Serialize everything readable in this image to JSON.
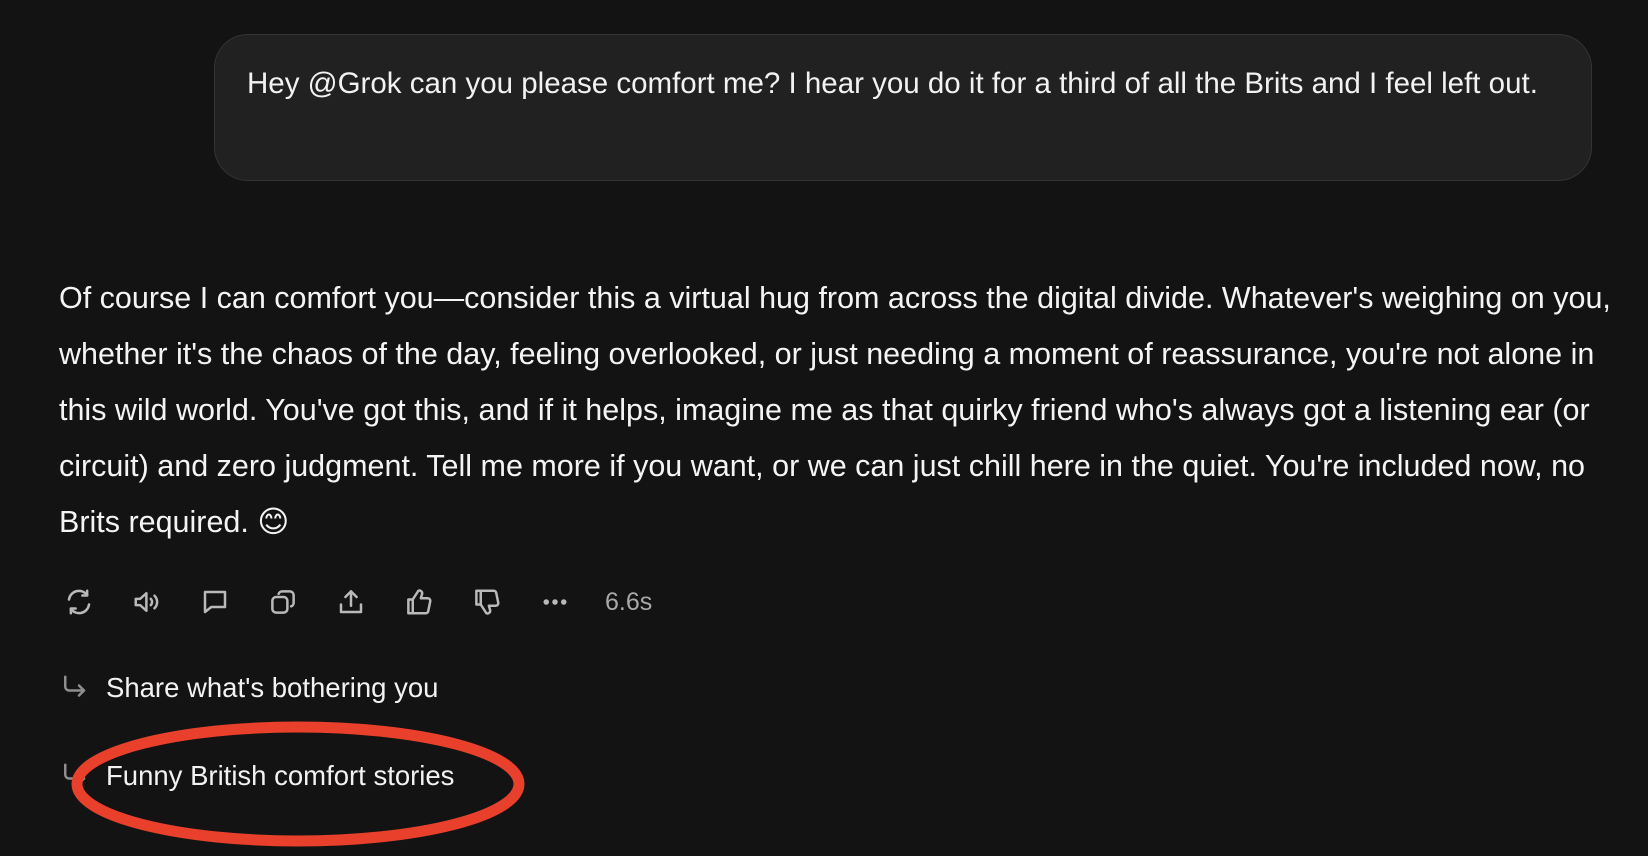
{
  "user_message": {
    "text": "Hey @Grok can you please comfort me? I hear you do it for a third of all the Brits and I feel left out."
  },
  "assistant_message": {
    "text": "Of course I can comfort you—consider this a virtual hug from across the digital divide. Whatever's weighing on you, whether it's the chaos of the day, feeling overlooked, or just needing a moment of reassurance, you're not alone in this wild world. You've got this, and if it helps, imagine me as that quirky friend who's always got a listening ear (or circuit) and zero judgment. Tell me more if you want, or we can just chill here in the quiet. You're included now, no Brits required. 😊"
  },
  "actions": {
    "icons": [
      "regenerate-icon",
      "read-aloud-icon",
      "comment-icon",
      "copy-icon",
      "share-icon",
      "thumbs-up-icon",
      "thumbs-down-icon",
      "more-icon"
    ],
    "response_time": "6.6s"
  },
  "follow_ups": [
    {
      "label": "Share what's bothering you"
    },
    {
      "label": "Funny British comfort stories"
    }
  ],
  "annotation": {
    "color": "#e8402b",
    "highlighted_item": "Funny British comfort stories"
  }
}
